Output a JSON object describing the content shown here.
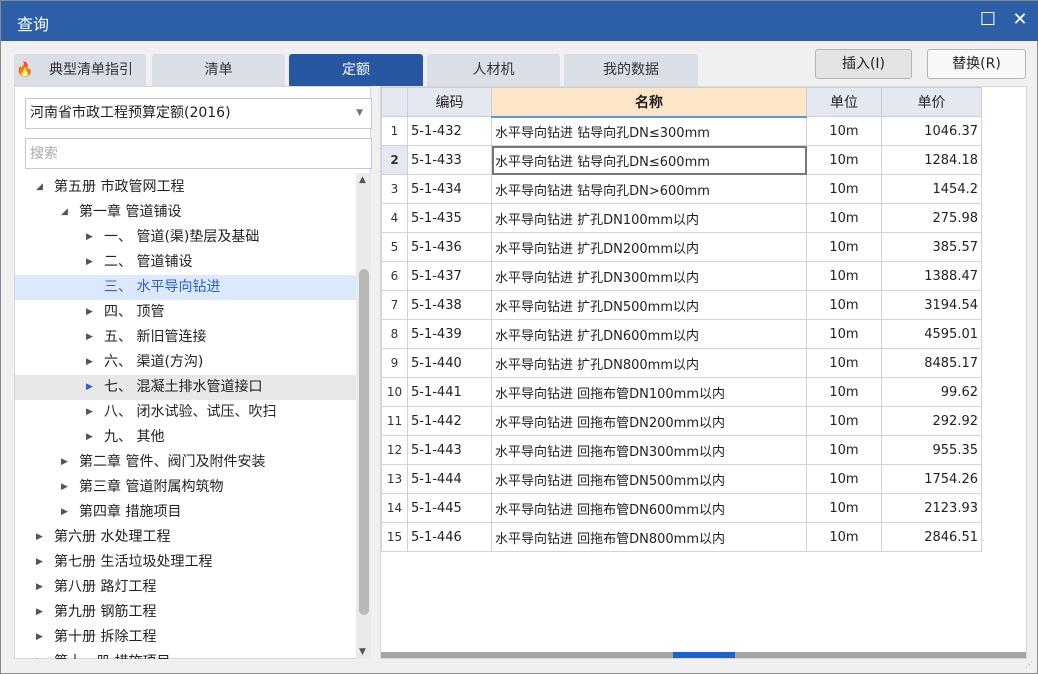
{
  "window": {
    "title": "查询"
  },
  "tabs": [
    {
      "label": "典型清单指引"
    },
    {
      "label": "清单"
    },
    {
      "label": "定额"
    },
    {
      "label": "人材机"
    },
    {
      "label": "我的数据"
    }
  ],
  "buttons": {
    "insert": "插入(I)",
    "replace": "替换(R)"
  },
  "dropdown": {
    "value": "河南省市政工程预算定额(2016)"
  },
  "search": {
    "placeholder": "搜索"
  },
  "tree": [
    {
      "label": "第五册 市政管网工程",
      "level": 0,
      "expanded": true
    },
    {
      "label": "第一章 管道铺设",
      "level": 1,
      "expanded": true
    },
    {
      "label": "一、 管道(渠)垫层及基础",
      "level": 2
    },
    {
      "label": "二、 管道铺设",
      "level": 2
    },
    {
      "label": "三、 水平导向钻进",
      "level": 2,
      "selected": true,
      "leaf": true
    },
    {
      "label": "四、 顶管",
      "level": 2
    },
    {
      "label": "五、 新旧管连接",
      "level": 2
    },
    {
      "label": "六、 渠道(方沟)",
      "level": 2
    },
    {
      "label": "七、 混凝土排水管道接口",
      "level": 2,
      "hover": true
    },
    {
      "label": "八、 闭水试验、试压、吹扫",
      "level": 2
    },
    {
      "label": "九、 其他",
      "level": 2
    },
    {
      "label": "第二章 管件、阀门及附件安装",
      "level": 1
    },
    {
      "label": "第三章 管道附属构筑物",
      "level": 1
    },
    {
      "label": "第四章 措施项目",
      "level": 1
    },
    {
      "label": "第六册 水处理工程",
      "level": 0
    },
    {
      "label": "第七册 生活垃圾处理工程",
      "level": 0
    },
    {
      "label": "第八册 路灯工程",
      "level": 0
    },
    {
      "label": "第九册 钢筋工程",
      "level": 0
    },
    {
      "label": "第十册 拆除工程",
      "level": 0
    },
    {
      "label": "第十一册 措施项目",
      "level": 0
    }
  ],
  "table": {
    "headers": {
      "code": "编码",
      "name": "名称",
      "unit": "单位",
      "price": "单价"
    },
    "rows": [
      {
        "n": "1",
        "code": "5-1-432",
        "name": "水平导向钻进 钻导向孔DN≤300mm",
        "unit": "10m",
        "price": "1046.37"
      },
      {
        "n": "2",
        "code": "5-1-433",
        "name": "水平导向钻进 钻导向孔DN≤600mm",
        "unit": "10m",
        "price": "1284.18"
      },
      {
        "n": "3",
        "code": "5-1-434",
        "name": "水平导向钻进 钻导向孔DN>600mm",
        "unit": "10m",
        "price": "1454.2"
      },
      {
        "n": "4",
        "code": "5-1-435",
        "name": "水平导向钻进 扩孔DN100mm以内",
        "unit": "10m",
        "price": "275.98"
      },
      {
        "n": "5",
        "code": "5-1-436",
        "name": "水平导向钻进 扩孔DN200mm以内",
        "unit": "10m",
        "price": "385.57"
      },
      {
        "n": "6",
        "code": "5-1-437",
        "name": "水平导向钻进 扩孔DN300mm以内",
        "unit": "10m",
        "price": "1388.47"
      },
      {
        "n": "7",
        "code": "5-1-438",
        "name": "水平导向钻进 扩孔DN500mm以内",
        "unit": "10m",
        "price": "3194.54"
      },
      {
        "n": "8",
        "code": "5-1-439",
        "name": "水平导向钻进 扩孔DN600mm以内",
        "unit": "10m",
        "price": "4595.01"
      },
      {
        "n": "9",
        "code": "5-1-440",
        "name": "水平导向钻进 扩孔DN800mm以内",
        "unit": "10m",
        "price": "8485.17"
      },
      {
        "n": "10",
        "code": "5-1-441",
        "name": "水平导向钻进 回拖布管DN100mm以内",
        "unit": "10m",
        "price": "99.62"
      },
      {
        "n": "11",
        "code": "5-1-442",
        "name": "水平导向钻进 回拖布管DN200mm以内",
        "unit": "10m",
        "price": "292.92"
      },
      {
        "n": "12",
        "code": "5-1-443",
        "name": "水平导向钻进 回拖布管DN300mm以内",
        "unit": "10m",
        "price": "955.35"
      },
      {
        "n": "13",
        "code": "5-1-444",
        "name": "水平导向钻进 回拖布管DN500mm以内",
        "unit": "10m",
        "price": "1754.26"
      },
      {
        "n": "14",
        "code": "5-1-445",
        "name": "水平导向钻进 回拖布管DN600mm以内",
        "unit": "10m",
        "price": "2123.93"
      },
      {
        "n": "15",
        "code": "5-1-446",
        "name": "水平导向钻进 回拖布管DN800mm以内",
        "unit": "10m",
        "price": "2846.51"
      }
    ]
  }
}
